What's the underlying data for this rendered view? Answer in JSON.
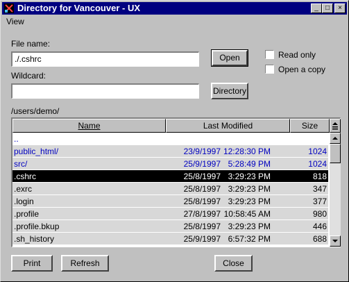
{
  "window": {
    "title": "Directory for Vancouver - UX",
    "controls": {
      "minimize": "_",
      "maximize": "□",
      "close": "×"
    }
  },
  "menu": {
    "view": "View"
  },
  "form": {
    "file_name_label": "File name:",
    "file_name_value": "./.cshrc",
    "open_label": "Open",
    "read_only_label": "Read only",
    "open_copy_label": "Open a copy",
    "wildcard_label": "Wildcard:",
    "wildcard_value": "",
    "directory_label": "Directory",
    "path": "/users/demo/"
  },
  "table": {
    "headers": {
      "name": "Name",
      "modified": "Last Modified",
      "size": "Size"
    },
    "rows": [
      {
        "name": "..",
        "date": "",
        "time": "",
        "size": "",
        "style": "blue"
      },
      {
        "name": "public_html/",
        "date": "23/9/1997",
        "time": "12:28:30 PM",
        "size": "1024",
        "style": "blue"
      },
      {
        "name": "src/",
        "date": "25/9/1997",
        "time": "5:28:49 PM",
        "size": "1024",
        "style": "blue"
      },
      {
        "name": ".cshrc",
        "date": "25/8/1997",
        "time": "3:29:23 PM",
        "size": "818",
        "style": "selected"
      },
      {
        "name": ".exrc",
        "date": "25/8/1997",
        "time": "3:29:23 PM",
        "size": "347",
        "style": "normal"
      },
      {
        "name": ".login",
        "date": "25/8/1997",
        "time": "3:29:23 PM",
        "size": "377",
        "style": "normal"
      },
      {
        "name": ".profile",
        "date": "27/8/1997",
        "time": "10:58:45 AM",
        "size": "980",
        "style": "normal"
      },
      {
        "name": ".profile.bkup",
        "date": "25/8/1997",
        "time": "3:29:23 PM",
        "size": "446",
        "style": "normal"
      },
      {
        "name": ".sh_history",
        "date": "25/9/1997",
        "time": "6:57:32 PM",
        "size": "688",
        "style": "normal"
      }
    ]
  },
  "footer": {
    "print_label": "Print",
    "refresh_label": "Refresh",
    "close_label": "Close"
  },
  "colors": {
    "title_bar": "#000080",
    "folder_text": "#0000c0",
    "selection": "#000000"
  },
  "icons": {
    "app": "x-app-icon",
    "sort": "sort-icon",
    "scroll_up": "arrow-up-icon",
    "scroll_down": "arrow-down-icon"
  }
}
